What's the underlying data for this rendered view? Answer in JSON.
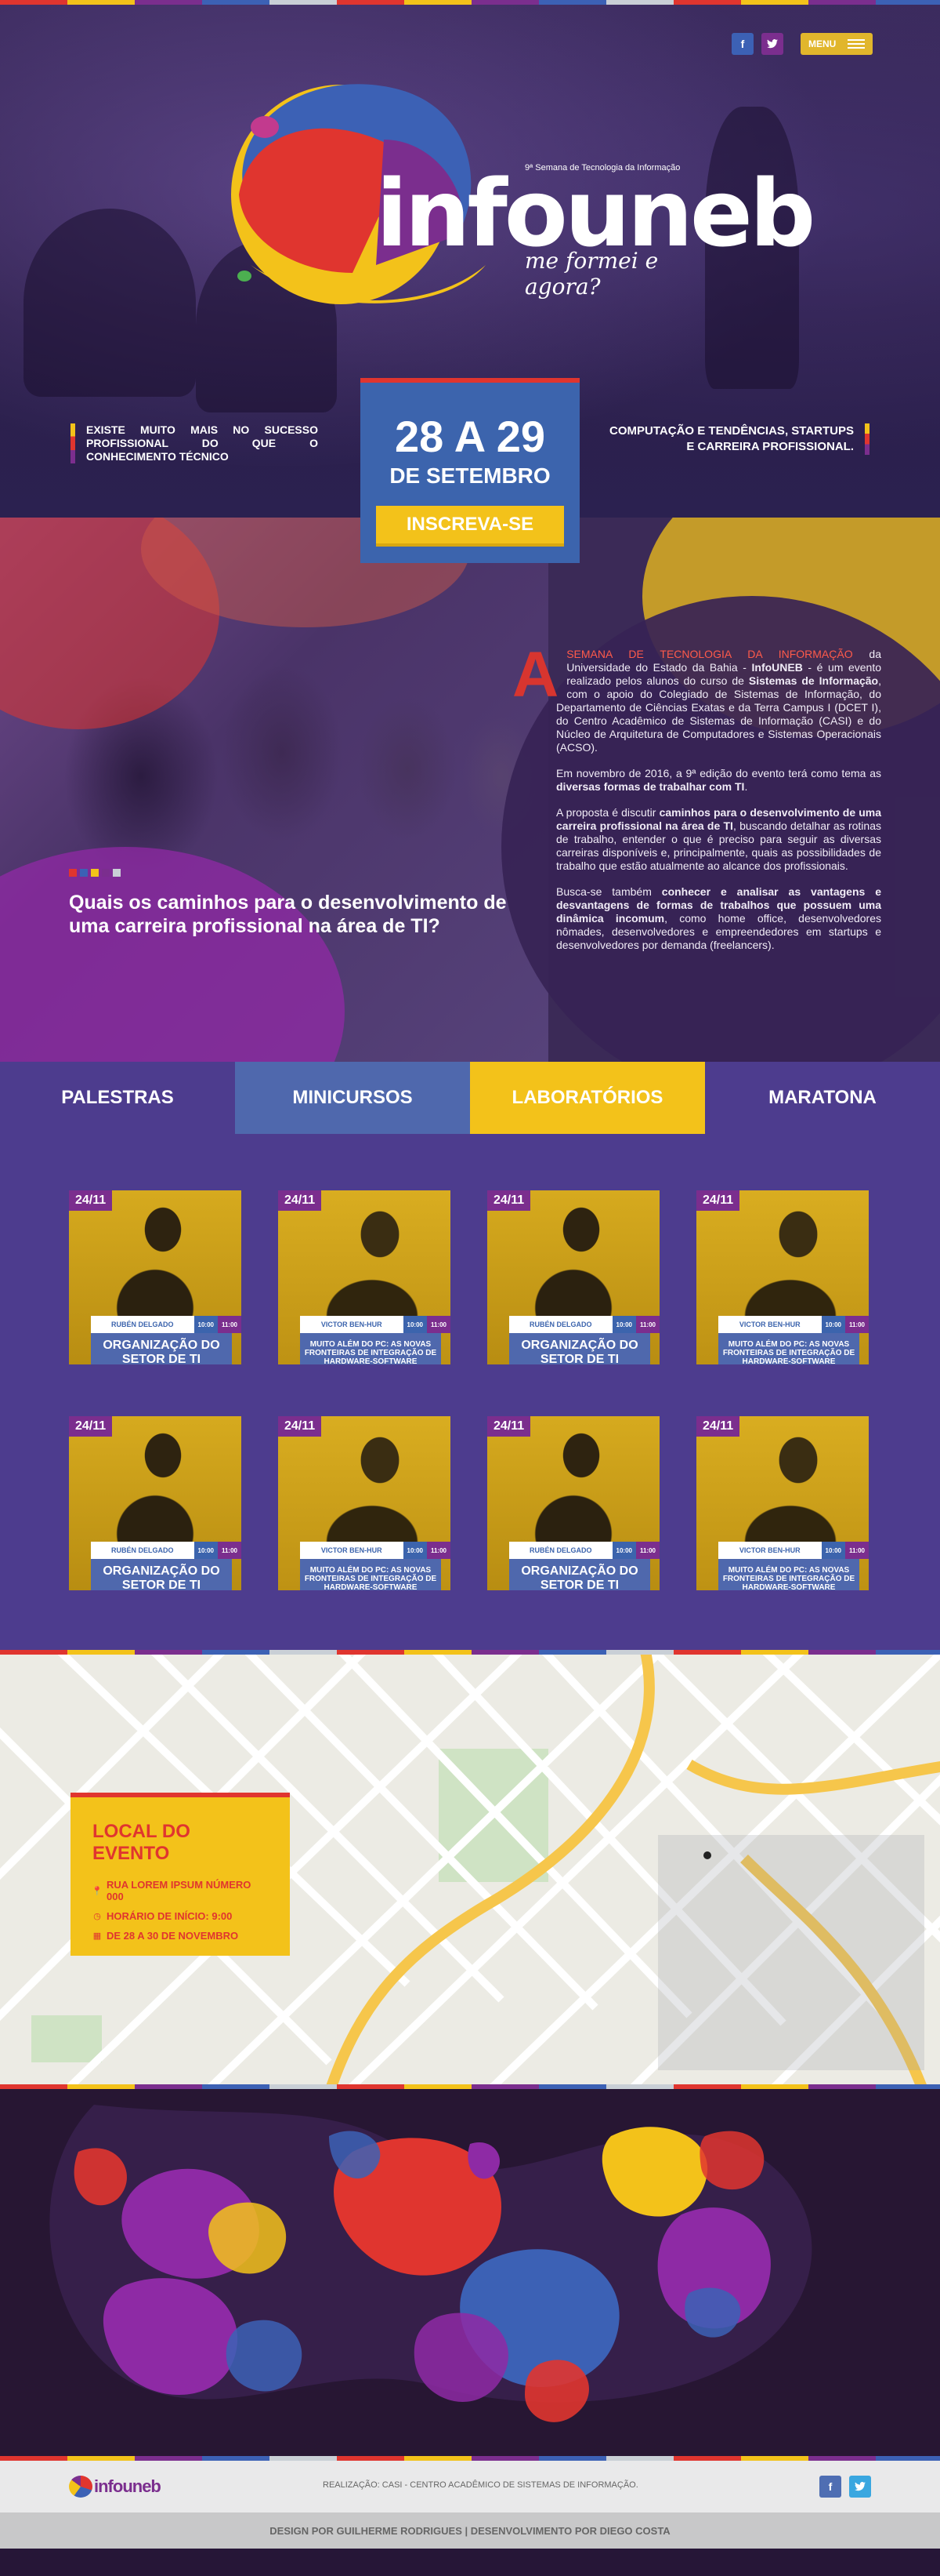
{
  "header": {
    "social": [
      {
        "icon": "facebook-icon",
        "label": "f"
      },
      {
        "icon": "twitter-icon",
        "label": "🐦"
      }
    ],
    "menu_label": "MENU"
  },
  "logo": {
    "edition": "9ª Semana de Tecnologia da Informação",
    "name": "infouneb",
    "tagline": "me formei e agora?"
  },
  "hero": {
    "left_claim": "EXISTE MUITO MAIS NO SUCESSO PROFISSIONAL DO QUE O CONHECIMENTO TÉCNICO",
    "date_range": "28 A 29",
    "date_month": "DE SETEMBRO",
    "cta": "INSCREVA-SE",
    "right_claim": "COMPUTAÇÃO E TENDÊNCIAS, STARTUPS E CARREIRA PROFISSIONAL."
  },
  "about": {
    "title": "Quais os caminhos para o desenvolvimento de uma carreira profissional na área de TI?",
    "dropcap": "A",
    "p1_lead": "SEMANA DE TECNOLOGIA DA INFORMAÇÃO",
    "p1_a": " da Universidade do Estado da Bahia - ",
    "p1_b": "InfoUNEB",
    "p1_c": " - é um evento realizado pelos alunos do curso de ",
    "p1_d": "Sistemas de Informação",
    "p1_e": ", com o apoio do Colegiado de Sistemas de Informação, do Departamento de Ciências Exatas e da Terra Campus I (DCET I), do Centro Acadêmico de Sistemas de Informação (CASI) e do Núcleo de Arquitetura de Computadores e Sistemas Operacionais (ACSO).",
    "p2_a": "Em novembro de 2016, a 9ª edição do evento terá como tema as ",
    "p2_b": "diversas formas de trabalhar com TI",
    "p2_c": ".",
    "p3_a": "A proposta é discutir ",
    "p3_b": "caminhos para o desenvolvimento de uma carreira profissional na área de TI",
    "p3_c": ", buscando detalhar as rotinas de trabalho, entender o que é preciso para seguir as diversas carreiras disponíveis e, principalmente, quais as possibilidades de trabalho que estão atualmente ao alcance dos profissionais.",
    "p4_a": "Busca-se também ",
    "p4_b": "conhecer e analisar as vantagens e desvantagens de formas de trabalhos que possuem uma dinâmica incomum",
    "p4_c": ", como home office, desenvolvedores nômades, desenvolvedores e empreendedores em startups e desenvolvedores por demanda (freelancers)."
  },
  "tabs": [
    "PALESTRAS",
    "MINICURSOS",
    "LABORATÓRIOS",
    "MARATONA"
  ],
  "cards": [
    {
      "date": "24/11",
      "speaker": "RUBÉN DELGADO",
      "start": "10:00",
      "end": "11:00",
      "title": "ORGANIZAÇÃO DO SETOR DE TI"
    },
    {
      "date": "24/11",
      "speaker": "VICTOR BEN-HUR",
      "start": "10:00",
      "end": "11:00",
      "title": "MUITO ALÉM DO PC: AS NOVAS FRONTEIRAS DE INTEGRAÇÃO DE HARDWARE-SOFTWARE"
    },
    {
      "date": "24/11",
      "speaker": "RUBÉN DELGADO",
      "start": "10:00",
      "end": "11:00",
      "title": "ORGANIZAÇÃO DO SETOR DE TI"
    },
    {
      "date": "24/11",
      "speaker": "VICTOR BEN-HUR",
      "start": "10:00",
      "end": "11:00",
      "title": "MUITO ALÉM DO PC: AS NOVAS FRONTEIRAS DE INTEGRAÇÃO DE HARDWARE-SOFTWARE"
    },
    {
      "date": "24/11",
      "speaker": "RUBÉN DELGADO",
      "start": "10:00",
      "end": "11:00",
      "title": "ORGANIZAÇÃO DO SETOR DE TI"
    },
    {
      "date": "24/11",
      "speaker": "VICTOR BEN-HUR",
      "start": "10:00",
      "end": "11:00",
      "title": "MUITO ALÉM DO PC: AS NOVAS FRONTEIRAS DE INTEGRAÇÃO DE HARDWARE-SOFTWARE"
    },
    {
      "date": "24/11",
      "speaker": "RUBÉN DELGADO",
      "start": "10:00",
      "end": "11:00",
      "title": "ORGANIZAÇÃO DO SETOR DE TI"
    },
    {
      "date": "24/11",
      "speaker": "VICTOR BEN-HUR",
      "start": "10:00",
      "end": "11:00",
      "title": "MUITO ALÉM DO PC: AS NOVAS FRONTEIRAS DE INTEGRAÇÃO DE HARDWARE-SOFTWARE"
    }
  ],
  "location": {
    "title": "LOCAL DO EVENTO",
    "address": "RUA LOREM IPSUM NÚMERO 000",
    "time": "HORÁRIO DE INÍCIO: 9:00",
    "dates": "DE 28 A 30 DE NOVEMBRO"
  },
  "footer": {
    "logo": "infouneb",
    "credit": "REALIZAÇÃO: CASI - CENTRO ACADÊMICO DE SISTEMAS DE INFORMAÇÃO.",
    "bottom": "DESIGN POR GUILHERME RODRIGUES  |  DESENVOLVIMENTO POR DIEGO COSTA"
  },
  "colors": {
    "red": "#e0352f",
    "yellow": "#f3c21a",
    "purple": "#7b2e8e",
    "blue": "#3c61b5",
    "indigo": "#4d3c8e"
  }
}
